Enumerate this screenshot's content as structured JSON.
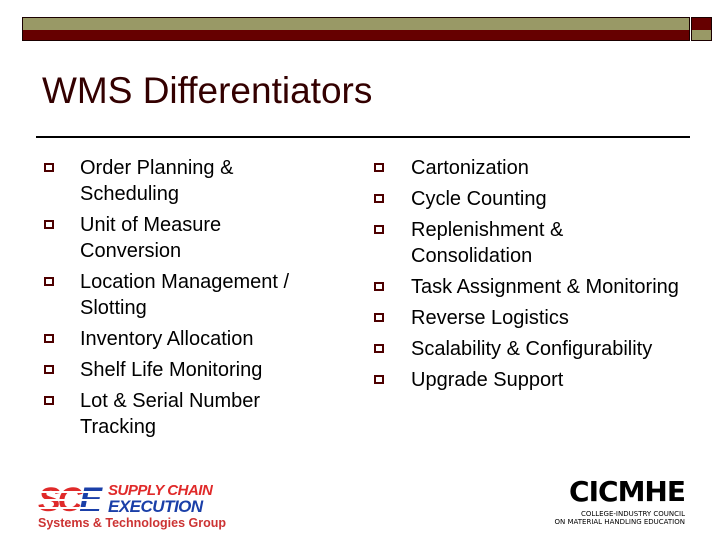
{
  "colors": {
    "olive": "#999966",
    "maroon": "#660000",
    "title_text": "#330000",
    "bullet_outline": "#4d0000",
    "sce_red": "#e02a2a",
    "sce_blue": "#1a3fa8"
  },
  "slide": {
    "title": "WMS Differentiators"
  },
  "left_list": {
    "bullet_icon": "hollow-square-icon",
    "items": [
      {
        "label": "Order Planning & Scheduling"
      },
      {
        "label": "Unit of Measure Conversion"
      },
      {
        "label": "Location Management / Slotting"
      },
      {
        "label": "Inventory Allocation"
      },
      {
        "label": "Shelf Life Monitoring"
      },
      {
        "label": "Lot & Serial Number Tracking"
      }
    ]
  },
  "right_list": {
    "bullet_icon": "hollow-square-icon",
    "items": [
      {
        "label": "Cartonization"
      },
      {
        "label": "Cycle Counting"
      },
      {
        "label": "Replenishment & Consolidation"
      },
      {
        "label": "Task Assignment & Monitoring"
      },
      {
        "label": "Reverse Logistics"
      },
      {
        "label": "Scalability & Configurability"
      },
      {
        "label": "Upgrade Support"
      }
    ]
  },
  "logos": {
    "sce": {
      "mark_sc": "SC",
      "mark_e": "E",
      "line1": "SUPPLY CHAIN",
      "line2": "EXECUTION",
      "line3": "Systems & Technologies Group"
    },
    "cicmhe": {
      "mark": "CICMHE",
      "caption1": "COLLEGE-INDUSTRY COUNCIL",
      "caption2": "ON MATERIAL HANDLING EDUCATION"
    }
  }
}
